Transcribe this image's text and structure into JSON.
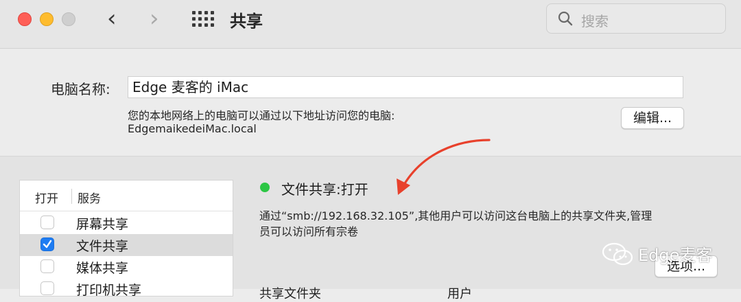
{
  "window": {
    "title": "共享",
    "search_placeholder": "搜索"
  },
  "computer": {
    "name_label": "电脑名称:",
    "name_value": "Edge 麦客的 iMac",
    "access_desc": "您的本地网络上的电脑可以通过以下地址访问您的电脑:",
    "local_address": "EdgemaikedeiMac.local",
    "edit_button": "编辑..."
  },
  "services": {
    "header_on": "打开",
    "header_service": "服务",
    "items": [
      {
        "label": "屏幕共享",
        "checked": false,
        "selected": false
      },
      {
        "label": "文件共享",
        "checked": true,
        "selected": true
      },
      {
        "label": "媒体共享",
        "checked": false,
        "selected": false
      },
      {
        "label": "打印机共享",
        "checked": false,
        "selected": false
      }
    ]
  },
  "detail": {
    "status": "文件共享:打开",
    "status_color": "#2cc644",
    "info_line1": "通过“smb://192.168.32.105”,其他用户可以访问这台电脑上的共享文件夹,管理",
    "info_line2": "员可以访问所有宗卷",
    "options_button": "选项...",
    "shared_folders_label": "共享文件夹",
    "users_label": "用户"
  },
  "watermark": {
    "text": "Edge麦客"
  },
  "colors": {
    "accent": "#1e7cf2",
    "arrow": "#e8412c"
  }
}
